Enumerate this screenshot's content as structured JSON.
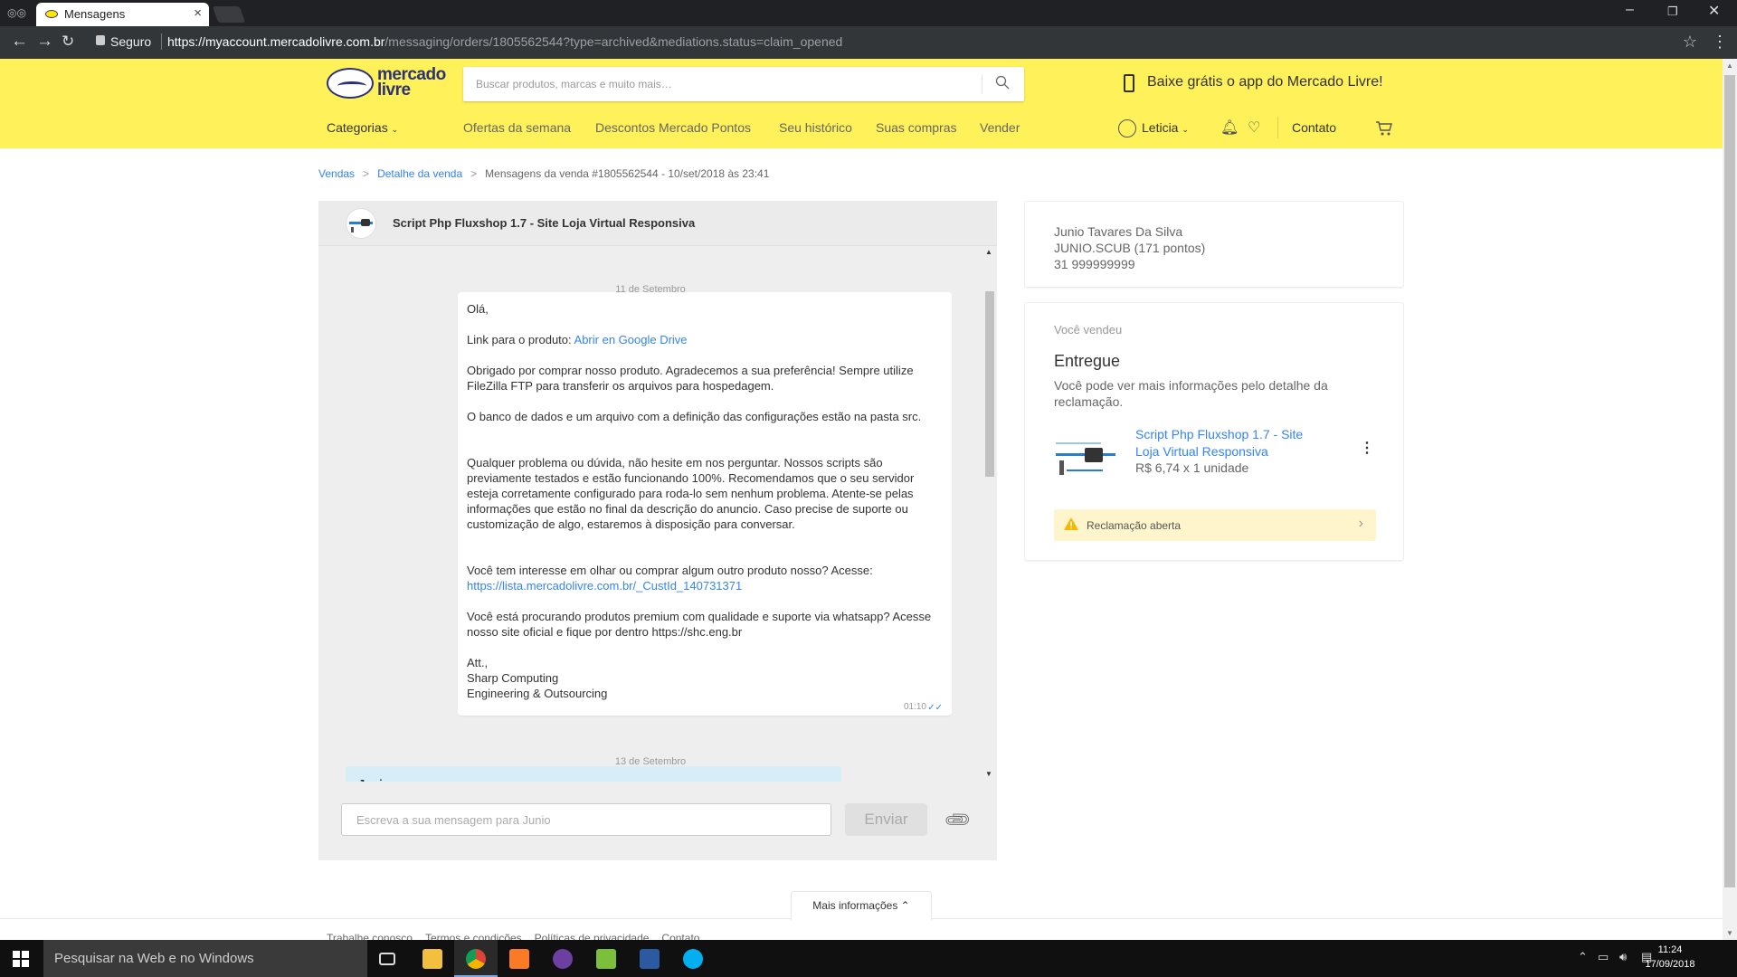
{
  "browser": {
    "tab_title": "Mensagens",
    "secure_label": "Seguro",
    "url_host": "https://myaccount.mercadolivre.com.br",
    "url_path": "/messaging/orders/1805562544?type=archived&mediations.status=claim_opened"
  },
  "header": {
    "logo_line1": "mercado",
    "logo_line2": "livre",
    "search_placeholder": "Buscar produtos, marcas e muito mais…",
    "app_promo": "Baixe grátis o app do Mercado Livre!",
    "categories": "Categorias",
    "nav": [
      "Ofertas da semana",
      "Descontos Mercado Pontos",
      "Seu histórico",
      "Suas compras",
      "Vender"
    ],
    "user": "Leticia",
    "contact": "Contato"
  },
  "breadcrumb": {
    "item1": "Vendas",
    "item2": "Detalhe da venda",
    "current": "Mensagens da venda #1805562544 - 10/set/2018 às 23:41",
    "separator": ">"
  },
  "chat": {
    "product_title": "Script Php Fluxshop 1.7 - Site Loja Virtual Responsiva",
    "day1": "11 de Setembro",
    "message": {
      "greeting": "Olá,",
      "link_prefix": "Link para o produto: ",
      "link_text": "Abrir en Google Drive",
      "p1": "Obrigado por comprar nosso produto. Agradecemos a sua preferência! Sempre utilize FileZilla FTP para transferir os arquivos para hospedagem.",
      "p2": "O banco de dados e um arquivo com a definição das configurações estão na pasta src.",
      "p3": "Qualquer problema ou dúvida, não hesite em nos perguntar. Nossos scripts são previamente testados e estão funcionando 100%. Recomendamos que o seu servidor esteja corretamente configurado para roda-lo sem nenhum problema. Atente-se pelas informações que estão no final da descrição do anuncio. Caso precise de suporte ou customização de algo, estaremos à disposição para conversar.",
      "p4": "Você tem interesse em olhar ou comprar algum outro produto nosso? Acesse:",
      "p4_link": "https://lista.mercadolivre.com.br/_CustId_140731371",
      "p5": "Você está procurando produtos premium com qualidade e suporte via whatsapp? Acesse nosso site oficial e fique por dentro https://shc.eng.br",
      "sign1": "Att.,",
      "sign2": "Sharp Computing",
      "sign3": "Engineering & Outsourcing",
      "time": "01:10"
    },
    "day2": "13 de Setembro",
    "next_sender": "Junio",
    "composer_placeholder": "Escreva a sua mensagem para Junio",
    "send_label": "Enviar"
  },
  "buyer": {
    "name": "Junio Tavares Da Silva",
    "nickname": "JUNIO.SCUB (171 pontos)",
    "phone": "31 999999999"
  },
  "sale": {
    "sold_label": "Você vendeu",
    "status": "Entregue",
    "status_desc": "Você pode ver mais informações pelo detalhe da reclamação.",
    "item_title": "Script Php Fluxshop 1.7 - Site Loja Virtual Responsiva",
    "item_price": "R$ 6,74 x 1 unidade",
    "claim": "Reclamação aberta"
  },
  "footer": {
    "more_info": "Mais informações",
    "links": [
      "Trabalhe conosco",
      "Termos e condições",
      "Políticas de privacidade",
      "Contato"
    ]
  },
  "taskbar": {
    "search_placeholder": "Pesquisar na Web e no Windows",
    "time": "11:24",
    "date": "17/09/2018"
  },
  "colors": {
    "brand_yellow": "#fff159",
    "brand_blue": "#2d3277",
    "link_blue": "#3483fa",
    "claim_bg": "#fff5cc"
  }
}
